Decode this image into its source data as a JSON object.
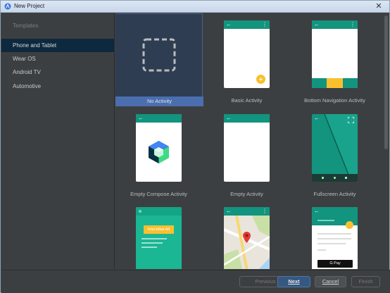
{
  "window": {
    "title": "New Project",
    "close_glyph": "✕"
  },
  "sidebar": {
    "heading": "Templates",
    "items": [
      {
        "label": "Phone and Tablet",
        "selected": true
      },
      {
        "label": "Wear OS",
        "selected": false
      },
      {
        "label": "Android TV",
        "selected": false
      },
      {
        "label": "Automotive",
        "selected": false
      }
    ]
  },
  "templates": [
    {
      "label": "No Activity",
      "selected": true
    },
    {
      "label": "Basic Activity",
      "selected": false
    },
    {
      "label": "Bottom Navigation Activity",
      "selected": false
    },
    {
      "label": "Empty Compose Activity",
      "selected": false
    },
    {
      "label": "Empty Activity",
      "selected": false
    },
    {
      "label": "Fullscreen Activity",
      "selected": false
    },
    {
      "label": "",
      "preview_text": "Interstitial Ad"
    },
    {
      "label": ""
    },
    {
      "label": "",
      "preview_text": "G Pay"
    }
  ],
  "footer": {
    "previous": "Previous",
    "next": "Next",
    "cancel": "Cancel",
    "finish": "Finish"
  },
  "colors": {
    "accent": "#12947e",
    "fab": "#f9c02e",
    "selection": "#4b6eaf",
    "dialog_bg": "#3c3f41"
  },
  "icons": {
    "back": "arrow-back-icon",
    "menu": "more-vert-icon",
    "fullscreen": "fullscreen-icon",
    "map_pin": "map-pin-icon"
  }
}
